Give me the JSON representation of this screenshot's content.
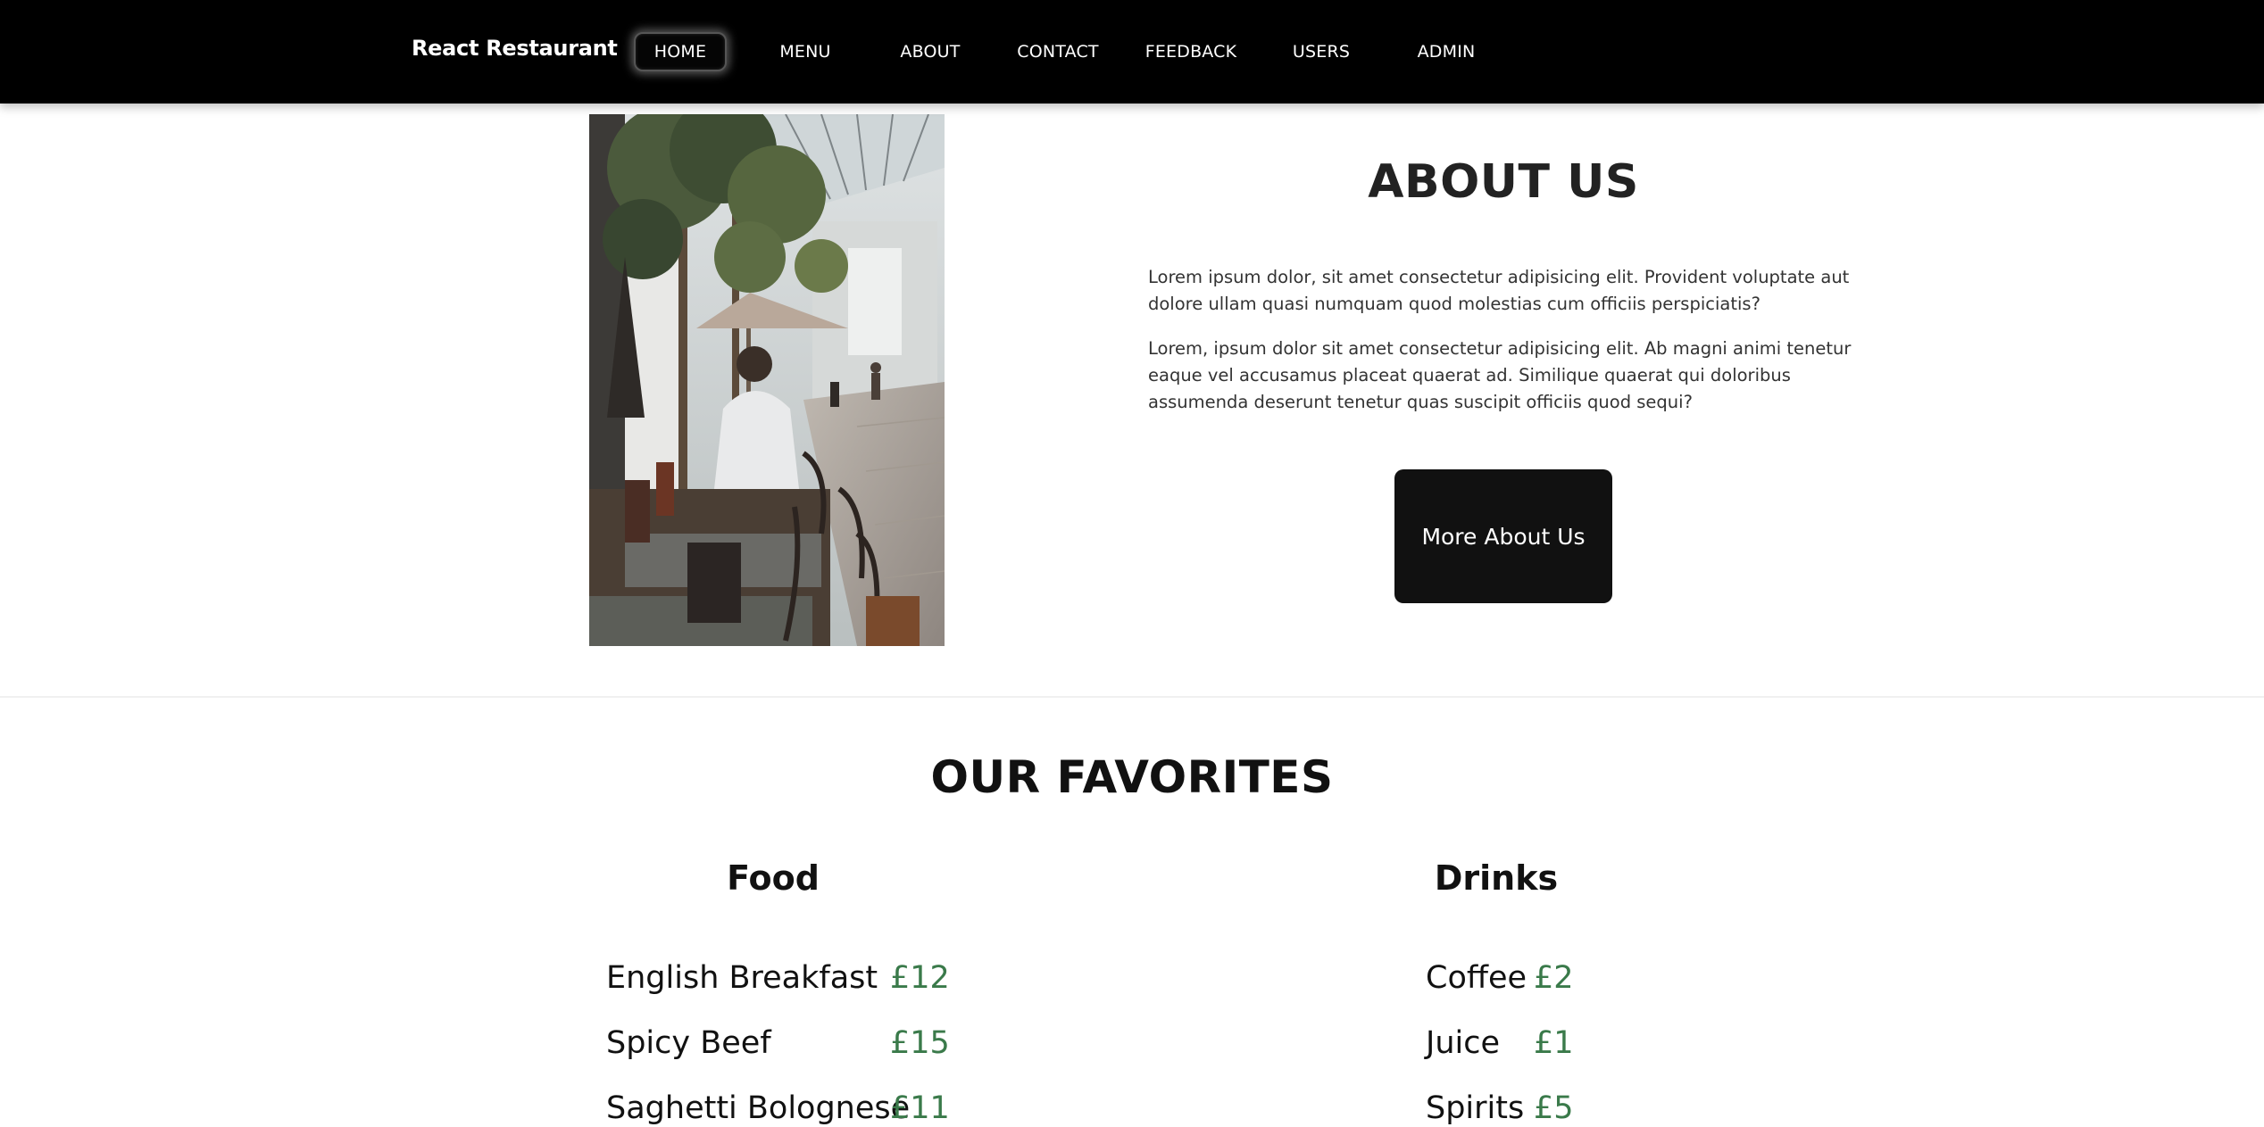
{
  "navbar": {
    "brand": "React Restaurant",
    "items": [
      {
        "label": "HOME",
        "active": true
      },
      {
        "label": "MENU"
      },
      {
        "label": "ABOUT"
      },
      {
        "label": "CONTACT"
      },
      {
        "label": "FEEDBACK"
      },
      {
        "label": "USERS"
      },
      {
        "label": "ADMIN"
      }
    ]
  },
  "about": {
    "title": "ABOUT US",
    "paragraph1": "Lorem ipsum dolor, sit amet consectetur adipisicing elit. Provident voluptate aut dolore ullam quasi numquam quod molestias cum officiis perspiciatis?",
    "paragraph2": "Lorem, ipsum dolor sit amet consectetur adipisicing elit. Ab magni animi tenetur eaque vel accusamus placeat quaerat ad. Similique quaerat qui doloribus assumenda deserunt tenetur quas suscipit officiis quod sequi?",
    "button_label": "More About Us"
  },
  "favorites": {
    "title": "OUR FAVORITES",
    "food": {
      "title": "Food",
      "items": [
        {
          "name": "English Breakfast",
          "price": "£12"
        },
        {
          "name": "Spicy Beef",
          "price": "£15"
        },
        {
          "name": "Saghetti Bolognese",
          "price": "£11"
        }
      ]
    },
    "drinks": {
      "title": "Drinks",
      "items": [
        {
          "name": "Coffee",
          "price": "£2"
        },
        {
          "name": "Juice",
          "price": "£1"
        },
        {
          "name": "Spirits",
          "price": "£5"
        }
      ]
    }
  },
  "colors": {
    "navbar_bg": "#000000",
    "button_bg": "#111111",
    "price_green": "#3a7a4a"
  }
}
